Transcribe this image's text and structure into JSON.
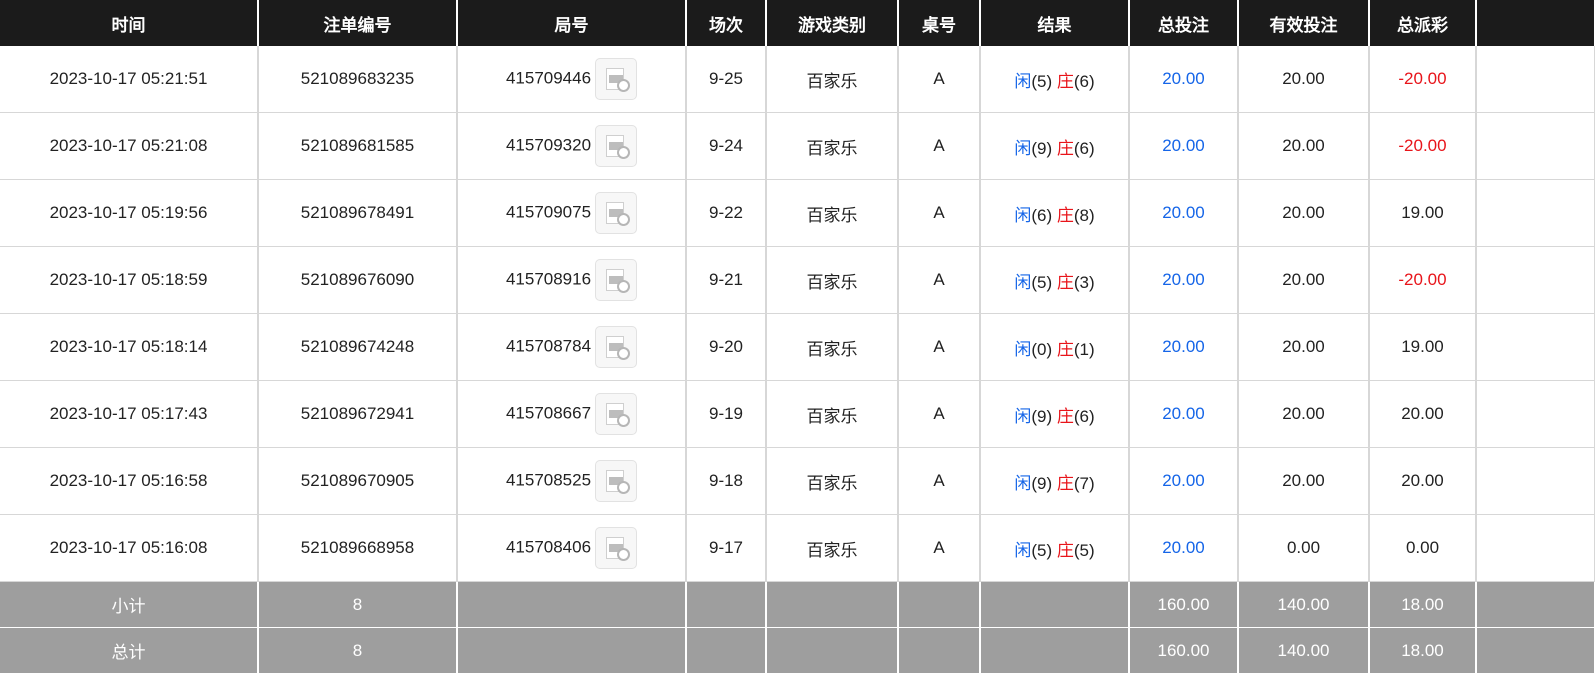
{
  "headers": [
    "时间",
    "注单编号",
    "局号",
    "场次",
    "游戏类别",
    "桌号",
    "结果",
    "总投注",
    "有效投注",
    "总派彩"
  ],
  "result_labels": {
    "player": "闲",
    "banker": "庄"
  },
  "colors": {
    "header_bg": "#1b1b1b",
    "summary_bg": "#9e9e9e",
    "blue": "#1565e8",
    "red": "#e8141a"
  },
  "icons": {
    "replay": "video-replay-icon"
  },
  "rows": [
    {
      "time": "2023-10-17 05:21:51",
      "bet_id": "521089683235",
      "round_id": "415709446",
      "session": "9-25",
      "game": "百家乐",
      "table": "A",
      "player_score": "(5)",
      "banker_score": "(6)",
      "total_bet": "20.00",
      "valid_bet": "20.00",
      "payout": "-20.00",
      "payout_negative": true
    },
    {
      "time": "2023-10-17 05:21:08",
      "bet_id": "521089681585",
      "round_id": "415709320",
      "session": "9-24",
      "game": "百家乐",
      "table": "A",
      "player_score": "(9)",
      "banker_score": "(6)",
      "total_bet": "20.00",
      "valid_bet": "20.00",
      "payout": "-20.00",
      "payout_negative": true
    },
    {
      "time": "2023-10-17 05:19:56",
      "bet_id": "521089678491",
      "round_id": "415709075",
      "session": "9-22",
      "game": "百家乐",
      "table": "A",
      "player_score": "(6)",
      "banker_score": "(8)",
      "total_bet": "20.00",
      "valid_bet": "20.00",
      "payout": "19.00",
      "payout_negative": false
    },
    {
      "time": "2023-10-17 05:18:59",
      "bet_id": "521089676090",
      "round_id": "415708916",
      "session": "9-21",
      "game": "百家乐",
      "table": "A",
      "player_score": "(5)",
      "banker_score": "(3)",
      "total_bet": "20.00",
      "valid_bet": "20.00",
      "payout": "-20.00",
      "payout_negative": true
    },
    {
      "time": "2023-10-17 05:18:14",
      "bet_id": "521089674248",
      "round_id": "415708784",
      "session": "9-20",
      "game": "百家乐",
      "table": "A",
      "player_score": "(0)",
      "banker_score": "(1)",
      "total_bet": "20.00",
      "valid_bet": "20.00",
      "payout": "19.00",
      "payout_negative": false
    },
    {
      "time": "2023-10-17 05:17:43",
      "bet_id": "521089672941",
      "round_id": "415708667",
      "session": "9-19",
      "game": "百家乐",
      "table": "A",
      "player_score": "(9)",
      "banker_score": "(6)",
      "total_bet": "20.00",
      "valid_bet": "20.00",
      "payout": "20.00",
      "payout_negative": false
    },
    {
      "time": "2023-10-17 05:16:58",
      "bet_id": "521089670905",
      "round_id": "415708525",
      "session": "9-18",
      "game": "百家乐",
      "table": "A",
      "player_score": "(9)",
      "banker_score": "(7)",
      "total_bet": "20.00",
      "valid_bet": "20.00",
      "payout": "20.00",
      "payout_negative": false
    },
    {
      "time": "2023-10-17 05:16:08",
      "bet_id": "521089668958",
      "round_id": "415708406",
      "session": "9-17",
      "game": "百家乐",
      "table": "A",
      "player_score": "(5)",
      "banker_score": "(5)",
      "total_bet": "20.00",
      "valid_bet": "0.00",
      "payout": "0.00",
      "payout_negative": false
    }
  ],
  "summary": [
    {
      "label": "小计",
      "count": "8",
      "total_bet": "160.00",
      "valid_bet": "140.00",
      "payout": "18.00"
    },
    {
      "label": "总计",
      "count": "8",
      "total_bet": "160.00",
      "valid_bet": "140.00",
      "payout": "18.00"
    }
  ]
}
